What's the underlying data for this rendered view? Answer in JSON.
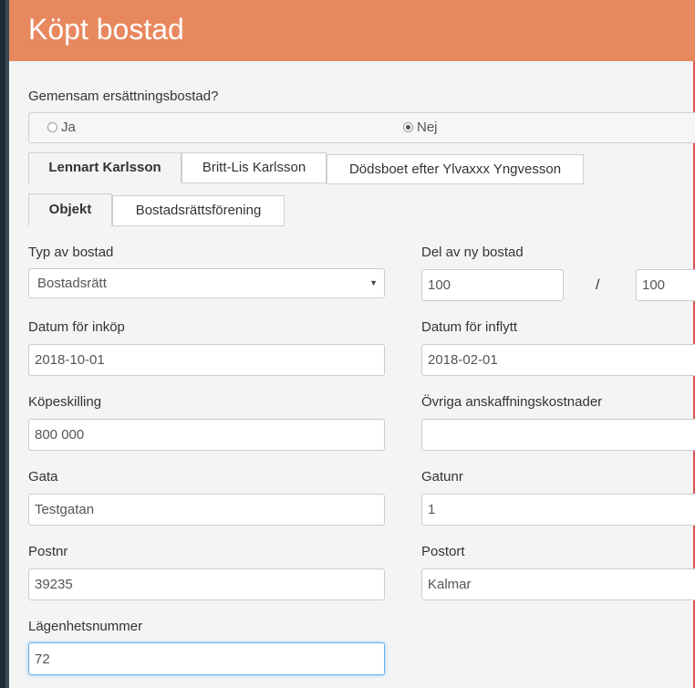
{
  "header": {
    "title": "Köpt bostad"
  },
  "shared_housing": {
    "label": "Gemensam ersättningsbostad?",
    "options": [
      {
        "label": "Ja",
        "checked": false
      },
      {
        "label": "Nej",
        "checked": true
      }
    ]
  },
  "person_tabs": [
    {
      "label": "Lennart Karlsson",
      "active": true
    },
    {
      "label": "Britt-Lis Karlsson",
      "active": false
    },
    {
      "label": "Dödsboet efter Ylvaxxx Yngvesson",
      "active": false
    }
  ],
  "section_tabs": [
    {
      "label": "Objekt",
      "active": true
    },
    {
      "label": "Bostadsrättsförening",
      "active": false
    }
  ],
  "form": {
    "housing_type": {
      "label": "Typ av bostad",
      "value": "Bostadsrätt"
    },
    "share": {
      "label": "Del av ny bostad",
      "numerator": "100",
      "separator": "/",
      "denominator": "100"
    },
    "purchase_date": {
      "label": "Datum för inköp",
      "value": "2018-10-01"
    },
    "move_in_date": {
      "label": "Datum för inflytt",
      "value": "2018-02-01"
    },
    "price": {
      "label": "Köpeskilling",
      "value": "800 000"
    },
    "other_costs": {
      "label": "Övriga anskaffningskostnader",
      "value": ""
    },
    "street": {
      "label": "Gata",
      "value": "Testgatan"
    },
    "street_no": {
      "label": "Gatunr",
      "value": "1"
    },
    "postal_code": {
      "label": "Postnr",
      "value": "39235"
    },
    "city": {
      "label": "Postort",
      "value": "Kalmar"
    },
    "apartment_no": {
      "label": "Lägenhetsnummer",
      "value": "72"
    }
  },
  "colors": {
    "header_bg": "#e8885f",
    "focus_border": "#66afe9"
  }
}
